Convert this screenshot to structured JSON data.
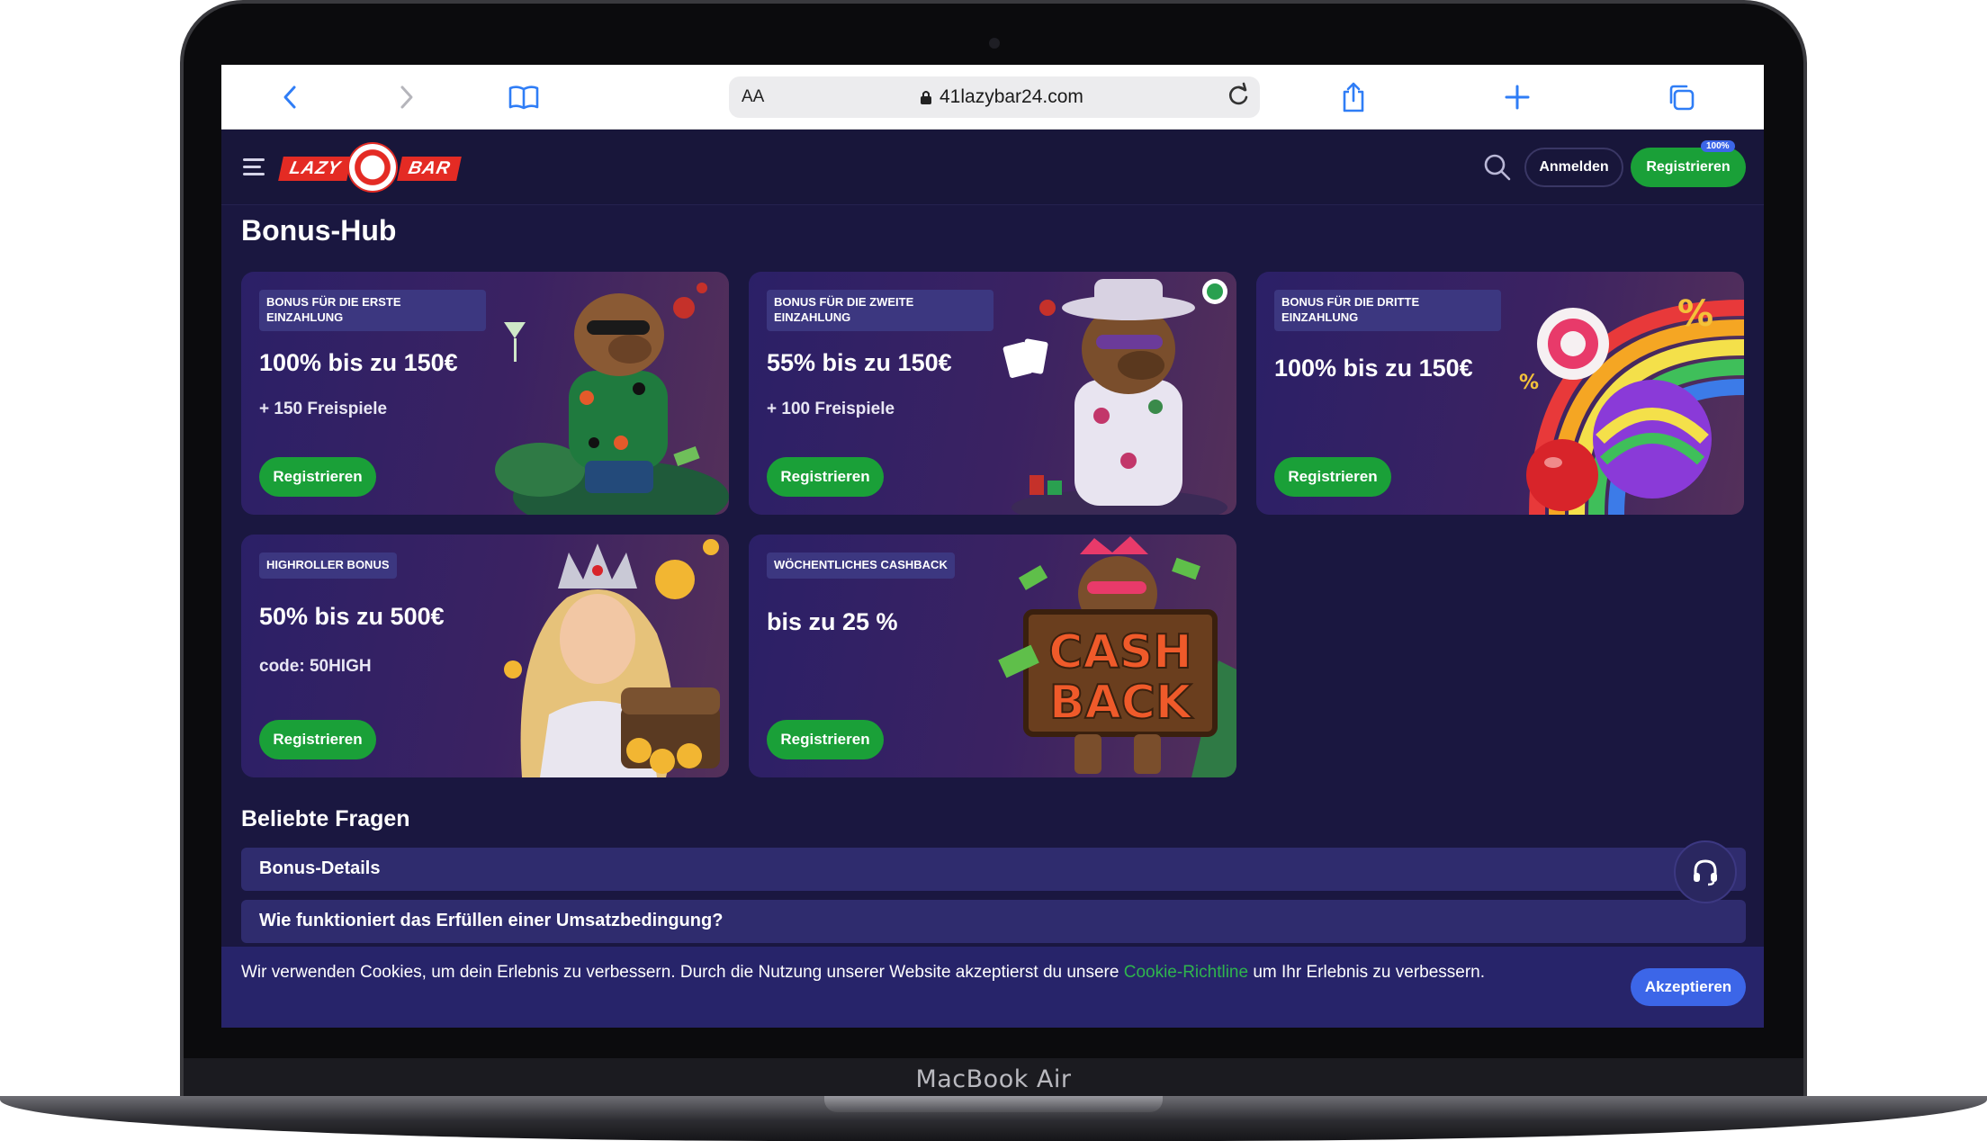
{
  "device": {
    "label": "MacBook Air"
  },
  "browser": {
    "text_size_label": "AA",
    "url": "41lazybar24.com"
  },
  "site": {
    "logo_left": "LAZY",
    "logo_right": "BAR",
    "login_label": "Anmelden",
    "register_label": "Registrieren",
    "register_badge": "100%"
  },
  "page": {
    "title": "Bonus-Hub"
  },
  "bonuses": [
    {
      "tag": "BONUS FÜR DIE ERSTE EINZAHLUNG",
      "headline": "100% bis zu 150€",
      "sub": "+ 150 Freispiele",
      "cta": "Registrieren",
      "art": "capybara-cocktail"
    },
    {
      "tag": "BONUS FÜR DIE ZWEITE EINZAHLUNG",
      "headline": "55% bis zu 150€",
      "sub": "+ 100 Freispiele",
      "cta": "Registrieren",
      "art": "capybara-poker"
    },
    {
      "tag": "BONUS FÜR DIE DRITTE EINZAHLUNG",
      "headline": "100% bis zu 150€",
      "sub": "",
      "cta": "Registrieren",
      "art": "candy-rainbow"
    },
    {
      "tag": "HIGHROLLER BONUS",
      "headline": "50% bis zu 500€",
      "sub": "code: 50HIGH",
      "cta": "Registrieren",
      "art": "queen-treasure"
    },
    {
      "tag": "WÖCHENTLICHES CASHBACK",
      "headline": "bis zu 25 %",
      "sub": "",
      "cta": "Registrieren",
      "art": "cashback-sign",
      "art_text_1": "CASH",
      "art_text_2": "BACK"
    }
  ],
  "faq": {
    "title": "Beliebte Fragen",
    "items": [
      "Bonus-Details",
      "Wie funktioniert das Erfüllen einer Umsatzbedingung?"
    ]
  },
  "cookie": {
    "text_before": "Wir verwenden Cookies, um dein Erlebnis zu verbessern. Durch die Nutzung unserer Website akzeptierst du unsere ",
    "link": "Cookie-Richtline",
    "text_after": " um Ihr Erlebnis zu verbessern.",
    "accept_label": "Akzeptieren"
  },
  "colors": {
    "page_bg": "#1a1740",
    "card_bg": "#2b2067",
    "primary_green": "#1aa038",
    "accent_blue": "#3c66e8",
    "link_green": "#2fb54d"
  }
}
